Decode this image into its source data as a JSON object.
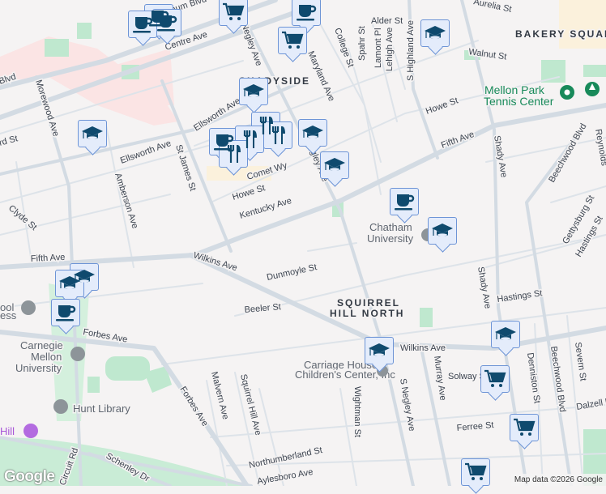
{
  "map": {
    "neighborhoods": [
      "SHADYSIDE",
      "BAKERY SQUARE",
      "SQUIRREL",
      "HILL NORTH"
    ],
    "streets": {
      "baum": "Baum Blvd",
      "baum2": "Blvd",
      "centre": "Centre Ave",
      "morewood": "Morewood Ave",
      "ellsworth": "Ellsworth Ave",
      "ellsworth2": "Ellsworth Ave",
      "amberson": "Amberson Ave",
      "stjames": "St James St",
      "comet": "Comet Wy",
      "howe": "Howe St",
      "kentucky": "Kentucky Ave",
      "snegley": "S Negley Ave",
      "snegley2": "S Negley Ave",
      "negley_top": "Negley Ave",
      "maryland": "Maryland Ave",
      "college": "College St",
      "spahr": "Spahr St",
      "lamont": "Lamont Pl",
      "lehigh": "Lehigh Ave",
      "highland": "S Highland Ave",
      "alder": "Alder St",
      "aurelia": "Aurelia St",
      "walnut": "Walnut St",
      "howe2": "Howe St",
      "fifth": "Fifth Ave",
      "fifth2": "Fifth Ave",
      "shady": "Shady Ave",
      "shady2": "Shady Ave",
      "beechwood": "Beechwood Blvd",
      "beechwood2": "Beechwood Blvd",
      "gettysburg": "Gettysburg St",
      "hastings": "Hastings St",
      "hastings2": "Hastings St",
      "wilkins": "Wilkins Ave",
      "wilkins2": "Wilkins Ave",
      "dunmoyle": "Dunmoyle St",
      "beeler": "Beeler St",
      "forbes": "Forbes Ave",
      "forbes2": "Forbes Ave",
      "malvern": "Malvern Ave",
      "squirrelhill": "Squirrel Hill Ave",
      "wightman": "Wightman St",
      "murray": "Murray Ave",
      "solway": "Solway St",
      "denniston": "Denniston St",
      "severn": "Severn St",
      "dalzell": "Dalzell Pl",
      "ferree": "Ferree St",
      "northumberland": "Northumberland St",
      "aylesboro": "Aylesboro Ave",
      "schenley": "Schenley Dr",
      "clyde": "Clyde St",
      "reynolds": "Reynolds",
      "circuit": "Circuit Rd",
      "ford": "rd St"
    },
    "pois": {
      "mellon1": "Mellon Park",
      "mellon2": "Tennis Center",
      "chatham1": "Chatham",
      "chatham2": "University",
      "carriage1": "Carriage House",
      "carriage2": "Children's Center, Inc",
      "cmu1": "Carnegie",
      "cmu2": "Mellon",
      "cmu3": "University",
      "hunt": "Hunt Library",
      "hill": "Hill",
      "school1": "ool",
      "school2": "ess"
    },
    "markers": [
      {
        "type": "coffee"
      },
      {
        "type": "coffee"
      },
      {
        "type": "coffee"
      },
      {
        "type": "cart"
      },
      {
        "type": "cart"
      },
      {
        "type": "graduation-cap"
      },
      {
        "type": "graduation-cap"
      },
      {
        "type": "restaurant"
      },
      {
        "type": "restaurant"
      },
      {
        "type": "graduation-cap"
      },
      {
        "type": "graduation-cap"
      },
      {
        "type": "graduation-cap"
      },
      {
        "type": "coffee"
      },
      {
        "type": "graduation-cap"
      },
      {
        "type": "graduation-cap"
      },
      {
        "type": "graduation-cap"
      },
      {
        "type": "coffee"
      },
      {
        "type": "graduation-cap"
      },
      {
        "type": "graduation-cap"
      },
      {
        "type": "cart"
      },
      {
        "type": "cart"
      },
      {
        "type": "cart"
      }
    ],
    "colors": {
      "marker_icon": "#0f4a6e",
      "marker_bg": "#e4ecfb",
      "marker_border": "#6d94d6",
      "park": "#bfe8cf",
      "road": "#d3dbe3"
    }
  },
  "footer": {
    "logo": "Google",
    "attribution": "Map data ©2026 Google"
  }
}
